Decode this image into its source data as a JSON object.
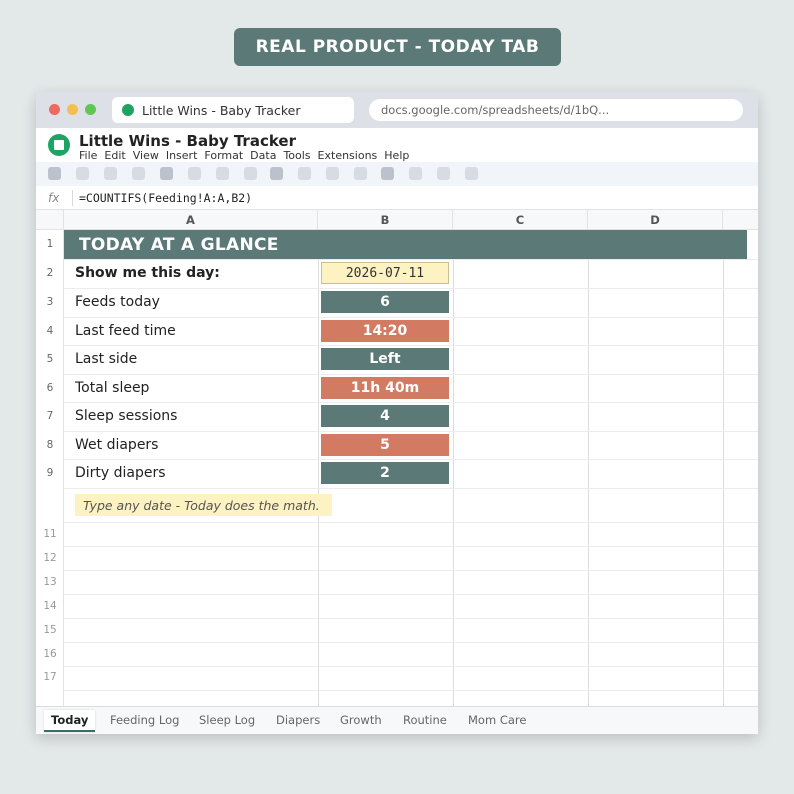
{
  "banner": {
    "text": "REAL PRODUCT - TODAY TAB"
  },
  "browser": {
    "tab_title": "Little Wins - Baby Tracker",
    "url": "docs.google.com/spreadsheets/d/1bQ..."
  },
  "app": {
    "title": "Little Wins - Baby Tracker",
    "menu": [
      "File",
      "Edit",
      "View",
      "Insert",
      "Format",
      "Data",
      "Tools",
      "Extensions",
      "Help"
    ]
  },
  "formula_bar": {
    "label": "fx",
    "value": "=COUNTIFS(Feeding!A:A,B2)"
  },
  "columns": [
    "A",
    "B",
    "C",
    "D"
  ],
  "rows": [
    "1",
    "2",
    "3",
    "4",
    "5",
    "6",
    "7",
    "8",
    "9",
    "11",
    "12",
    "13",
    "14",
    "15",
    "16",
    "17"
  ],
  "sheet": {
    "title": "TODAY AT A GLANCE",
    "date_label": "Show me this day:",
    "date_value": "2026-07-11",
    "metrics": [
      {
        "label": "Feeds today",
        "value": "6"
      },
      {
        "label": "Last feed time",
        "value": "14:20"
      },
      {
        "label": "Last side",
        "value": "Left"
      },
      {
        "label": "Total sleep",
        "value": "11h 40m"
      },
      {
        "label": "Sleep sessions",
        "value": "4"
      },
      {
        "label": "Wet diapers",
        "value": "5"
      },
      {
        "label": "Dirty diapers",
        "value": "2"
      }
    ],
    "note": "Type any date - Today does the math."
  },
  "tabs": [
    "Today",
    "Feeding Log",
    "Sleep Log",
    "Diapers",
    "Growth",
    "Routine",
    "Mom Care"
  ],
  "colors": {
    "teal": "#5b7a77",
    "coral": "#d37b62",
    "highlight": "#fdf2c2"
  }
}
